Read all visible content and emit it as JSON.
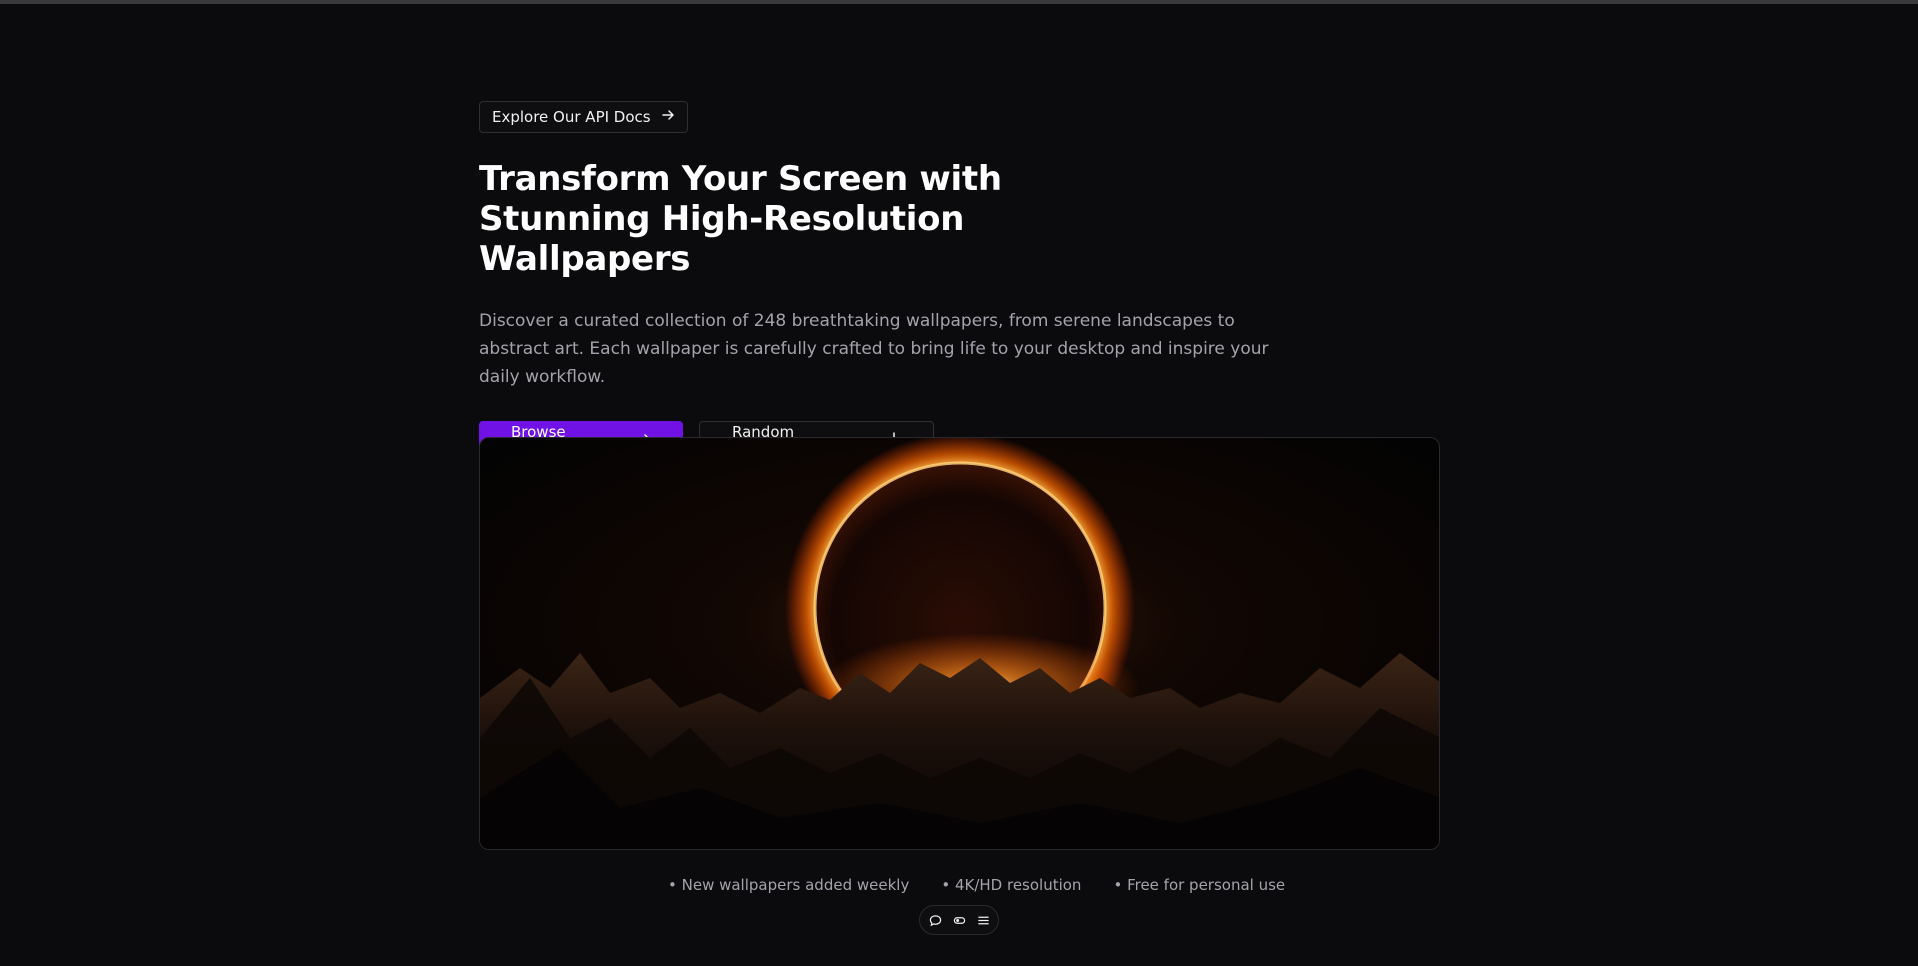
{
  "api_link": {
    "label": "Explore Our API Docs",
    "icon": "arrow-right-icon"
  },
  "hero": {
    "title": "Transform Your Screen with Stunning High-Resolution Wallpapers",
    "description": "Discover a curated collection of 248 breathtaking wallpapers, from serene landscapes to abstract art. Each wallpaper is carefully crafted to bring life to your desktop and inspire your daily workflow."
  },
  "actions": {
    "browse_label": "Browse Gallery",
    "browse_icon": "arrow-right-icon",
    "random_label": "Random Wallpaper",
    "random_icon": "download-icon"
  },
  "features": [
    "• New wallpapers added weekly",
    "• 4K/HD resolution",
    "• Free for personal use"
  ],
  "toolbar": {
    "icons": [
      "chat-bubble-icon",
      "toggle-icon",
      "menu-icon"
    ]
  },
  "colors": {
    "background": "#0b0b0d",
    "accent": "#7011e6",
    "text_muted": "#a3a3ab"
  }
}
